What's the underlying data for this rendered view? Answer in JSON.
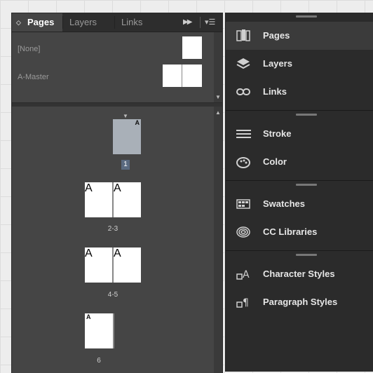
{
  "pages_panel": {
    "tabs": [
      {
        "label": "Pages"
      },
      {
        "label": "Layers"
      },
      {
        "label": "Links"
      }
    ],
    "collapse_icon": "double-arrow-right-icon",
    "menu_icon": "panel-menu-icon",
    "masters": [
      {
        "label": "[None]"
      },
      {
        "label": "A-Master"
      }
    ],
    "pages": [
      {
        "number": "1",
        "selected": true
      },
      {
        "number": "2-3"
      },
      {
        "number": "4-5"
      },
      {
        "number": "6"
      }
    ],
    "master_marker": "A"
  },
  "dock": {
    "items": [
      {
        "label": "Pages",
        "icon": "pages-icon",
        "active": true
      },
      {
        "label": "Layers",
        "icon": "layers-icon"
      },
      {
        "label": "Links",
        "icon": "links-icon"
      },
      {
        "label": "Stroke",
        "icon": "stroke-icon"
      },
      {
        "label": "Color",
        "icon": "color-icon"
      },
      {
        "label": "Swatches",
        "icon": "swatches-icon"
      },
      {
        "label": "CC Libraries",
        "icon": "cc-libraries-icon"
      },
      {
        "label": "Character Styles",
        "icon": "character-styles-icon"
      },
      {
        "label": "Paragraph Styles",
        "icon": "paragraph-styles-icon"
      }
    ]
  }
}
